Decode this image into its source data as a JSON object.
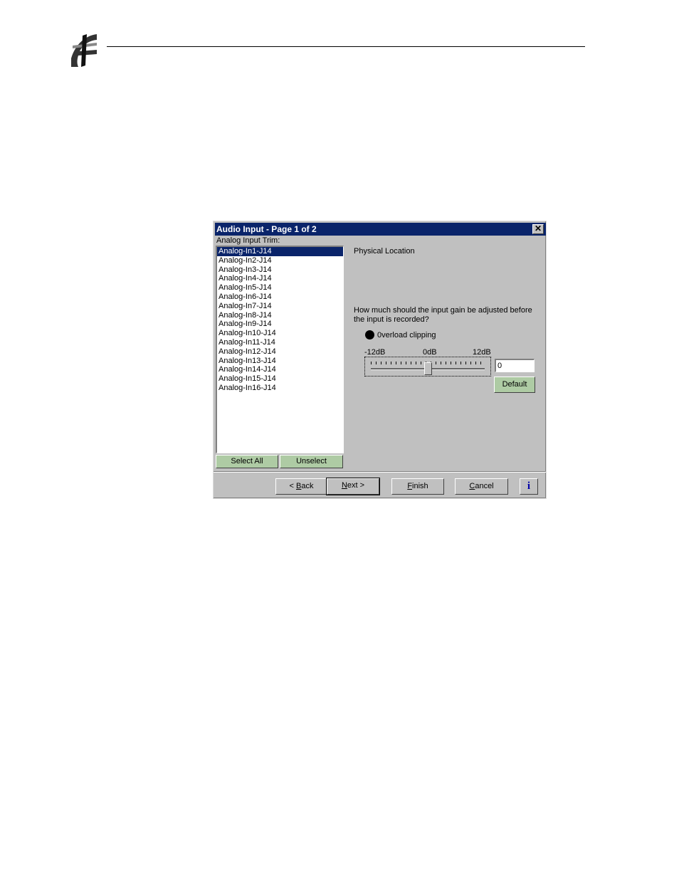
{
  "dialog": {
    "title": "Audio Input - Page 1 of 2",
    "close_glyph": "✕",
    "trim_label": "Analog Input Trim:",
    "inputs": [
      "Analog-In1-J14",
      "Analog-In2-J14",
      "Analog-In3-J14",
      "Analog-In4-J14",
      "Analog-In5-J14",
      "Analog-In6-J14",
      "Analog-In7-J14",
      "Analog-In8-J14",
      "Analog-In9-J14",
      "Analog-In10-J14",
      "Analog-In11-J14",
      "Analog-In12-J14",
      "Analog-In13-J14",
      "Analog-In14-J14",
      "Analog-In15-J14",
      "Analog-In16-J14"
    ],
    "selected_index": 0,
    "select_all_label": "Select All",
    "unselect_label": "Unselect",
    "physical_location_label": "Physical Location",
    "gain_question": "How much should the input gain be adjusted before the input is recorded?",
    "overload_label": "0verload clipping",
    "slider": {
      "min_label": "-12dB",
      "mid_label": "0dB",
      "max_label": "12dB",
      "min": -12,
      "max": 12,
      "value": 0
    },
    "gain_value": "0",
    "default_label": "Default",
    "nav": {
      "back_prefix": "< ",
      "back_accel": "B",
      "back_rest": "ack",
      "next_accel": "N",
      "next_rest": "ext >",
      "finish_accel": "F",
      "finish_rest": "inish",
      "cancel_accel": "C",
      "cancel_rest": "ancel",
      "info_label": "i"
    },
    "colors": {
      "titlebar": "#0a246a",
      "face": "#c0c0c0",
      "action_button": "#aecba4"
    }
  }
}
